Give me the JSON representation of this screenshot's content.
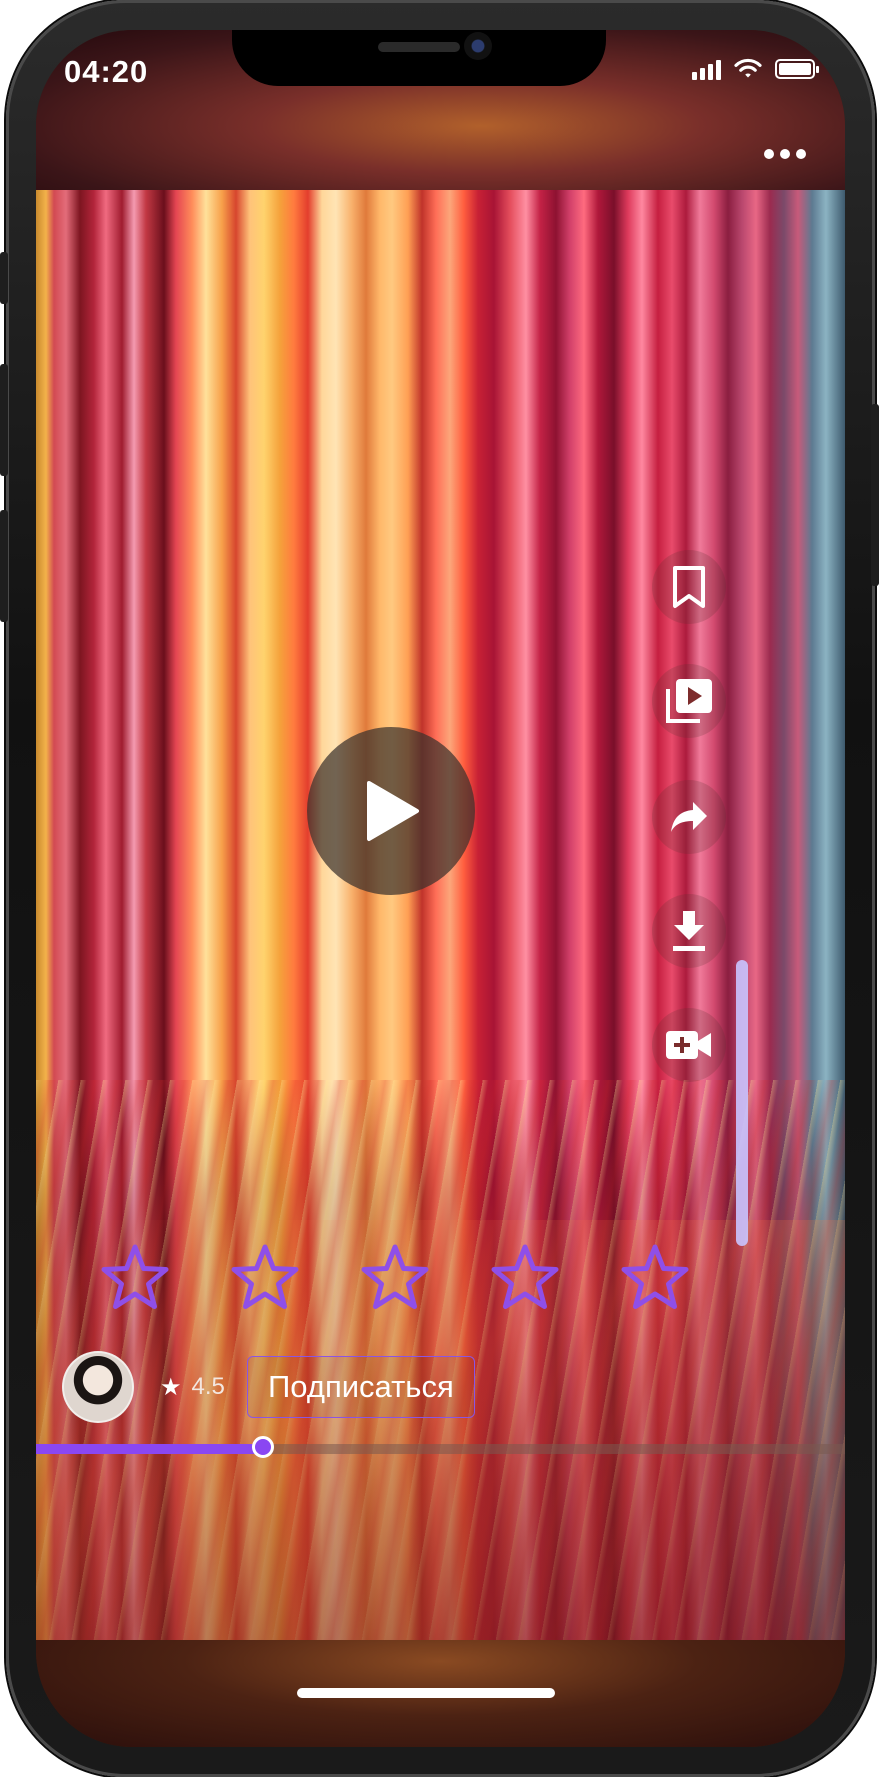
{
  "status_bar": {
    "time": "04:20"
  },
  "player": {
    "progress": 0.28
  },
  "rating": {
    "value": "4.5",
    "star_glyph": "★",
    "user_stars": 5
  },
  "author": {
    "subscribe_label": "Подписаться"
  },
  "colors": {
    "accent": "#8a47f2",
    "rail": "#c9c4ff"
  },
  "side_actions": [
    "bookmark-icon",
    "playlist-icon",
    "share-icon",
    "download-icon",
    "video-add-icon"
  ]
}
